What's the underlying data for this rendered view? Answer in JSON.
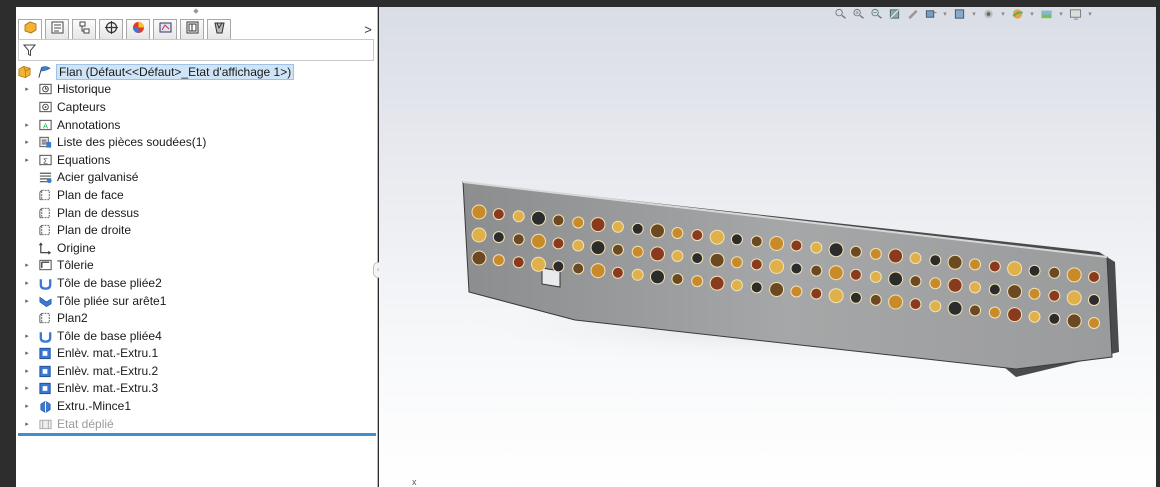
{
  "app": {
    "accent": "#3f8fd0",
    "selection_bg": "#cfe4f7"
  },
  "panel": {
    "tabs": [
      {
        "icon": "feature-manager-icon",
        "active": true
      },
      {
        "icon": "property-manager-icon",
        "active": false
      },
      {
        "icon": "configuration-manager-icon",
        "active": false
      },
      {
        "icon": "dimxpert-manager-icon",
        "active": false
      },
      {
        "icon": "display-manager-icon",
        "active": false
      },
      {
        "icon": "cam-icon",
        "active": false
      },
      {
        "icon": "drawing-icon",
        "active": false
      },
      {
        "icon": "toolbox-icon",
        "active": false
      }
    ],
    "more_label": ">",
    "filter_icon": "filter-icon"
  },
  "tree": {
    "root": {
      "label": "Flan  (Défaut<<Défaut>_Etat d'affichage 1>)",
      "icon": "part-icon"
    },
    "items": [
      {
        "label": "Historique",
        "icon": "history-icon",
        "expandable": true
      },
      {
        "label": "Capteurs",
        "icon": "sensors-icon",
        "expandable": false
      },
      {
        "label": "Annotations",
        "icon": "annotations-icon",
        "expandable": true
      },
      {
        "label": "Liste des pièces soudées(1)",
        "icon": "cut-list-icon",
        "expandable": true
      },
      {
        "label": "Equations",
        "icon": "equations-icon",
        "expandable": true
      },
      {
        "label": "Acier galvanisé",
        "icon": "material-icon",
        "expandable": false
      },
      {
        "label": "Plan de face",
        "icon": "plane-icon",
        "expandable": false
      },
      {
        "label": "Plan de dessus",
        "icon": "plane-icon",
        "expandable": false
      },
      {
        "label": "Plan de droite",
        "icon": "plane-icon",
        "expandable": false
      },
      {
        "label": "Origine",
        "icon": "origin-icon",
        "expandable": false
      },
      {
        "label": "Tôlerie",
        "icon": "sheet-metal-icon",
        "expandable": true
      },
      {
        "label": "Tôle de base pliée2",
        "icon": "base-flange-icon",
        "expandable": true
      },
      {
        "label": "Tôle pliée sur arête1",
        "icon": "edge-flange-icon",
        "expandable": true
      },
      {
        "label": "Plan2",
        "icon": "plane-icon",
        "expandable": false
      },
      {
        "label": "Tôle de base pliée4",
        "icon": "base-flange-icon",
        "expandable": true
      },
      {
        "label": "Enlèv. mat.-Extru.1",
        "icon": "extruded-cut-icon",
        "expandable": true
      },
      {
        "label": "Enlèv. mat.-Extru.2",
        "icon": "extruded-cut-icon",
        "expandable": true
      },
      {
        "label": "Enlèv. mat.-Extru.3",
        "icon": "extruded-cut-icon",
        "expandable": true
      },
      {
        "label": "Extru.-Mince1",
        "icon": "thin-extrude-icon",
        "expandable": true
      },
      {
        "label": "Etat déplié",
        "icon": "flat-pattern-icon",
        "expandable": true,
        "suppressed": true
      }
    ]
  },
  "viewport": {
    "toolbar_icons": [
      "zoom-to-fit-icon",
      "zoom-area-icon",
      "previous-view-icon",
      "section-view-icon",
      "dynamic-annotation-icon",
      "view-orientation-icon",
      "display-style-icon",
      "hide-show-icon",
      "edit-appearance-icon",
      "apply-scene-icon",
      "view-settings-icon"
    ],
    "triad_label": "x"
  }
}
